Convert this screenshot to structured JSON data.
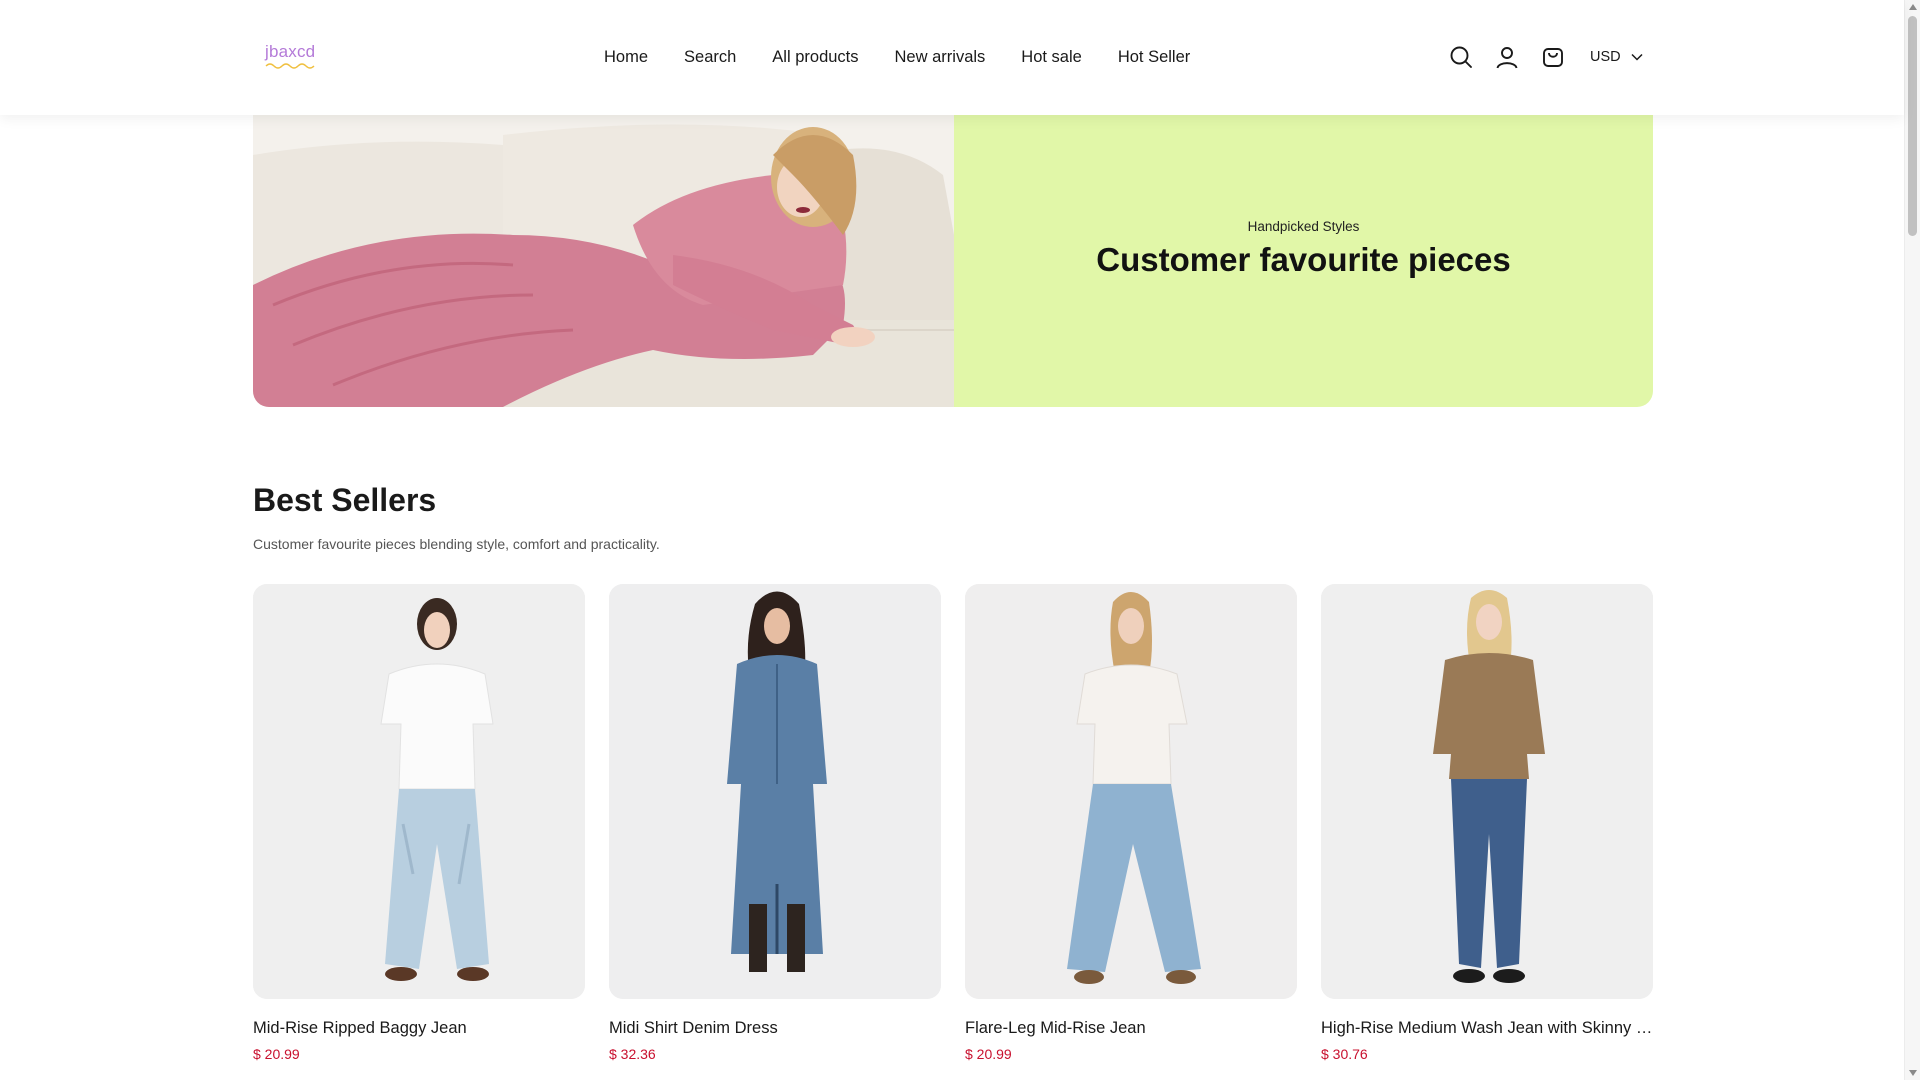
{
  "header": {
    "logo_text": "jbaxcd",
    "nav": [
      "Home",
      "Search",
      "All products",
      "New arrivals",
      "Hot sale",
      "Hot Seller"
    ],
    "currency": "USD",
    "icons": [
      "search-icon",
      "account-icon",
      "cart-icon",
      "chevron-down-icon"
    ]
  },
  "hero": {
    "eyebrow": "Handpicked Styles",
    "title": "Customer favourite pieces",
    "panel_color": "#e1f7a8"
  },
  "section": {
    "title": "Best Sellers",
    "subtitle": "Customer favourite pieces blending style, comfort and practicality."
  },
  "products": [
    {
      "name": "Mid-Rise Ripped Baggy Jean",
      "price": "$ 20.99"
    },
    {
      "name": "Midi Shirt Denim Dress",
      "price": "$ 32.36"
    },
    {
      "name": "Flare-Leg Mid-Rise Jean",
      "price": "$ 20.99"
    },
    {
      "name": "High-Rise Medium Wash Jean with Skinny Leg Profile",
      "price": "$ 30.76"
    }
  ],
  "colors": {
    "price": "#c8102e",
    "logo": "#b47ad8"
  }
}
